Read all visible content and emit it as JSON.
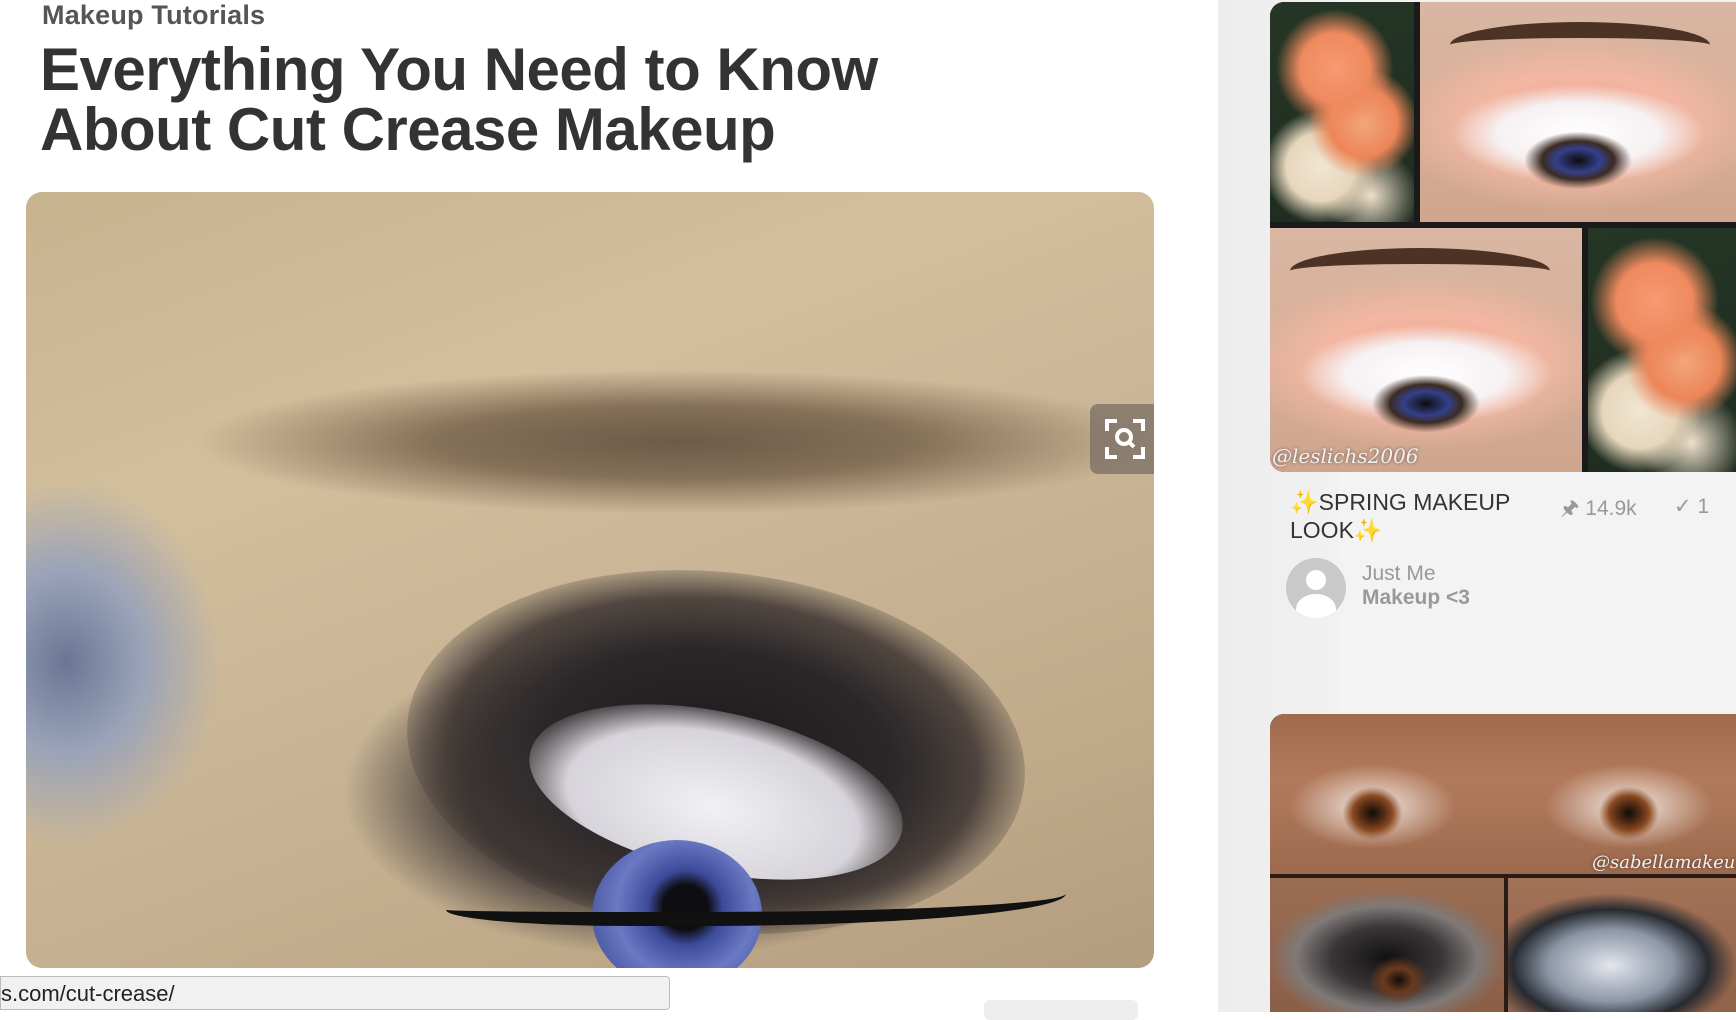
{
  "article": {
    "category": "Makeup Tutorials",
    "title_line1": "Everything You Need to Know",
    "title_line2": "About Cut Crease Makeup"
  },
  "url_bar": {
    "text": "s.com/cut-crease/"
  },
  "side_pin_1": {
    "title_line1": "✨SPRING MAKEUP",
    "title_line2": "LOOK✨",
    "saves": "14.9k",
    "tried": "1",
    "watermark": "@leslichs2006",
    "user": {
      "name_line1": "Just Me",
      "name_line2": "Makeup <3"
    }
  },
  "side_pin_2": {
    "watermark": "@sabellamakeup"
  },
  "icons": [
    "zoom-search-icon",
    "pin-icon",
    "check-icon",
    "user-avatar-icon"
  ],
  "colors": {
    "title": "#333333",
    "muted": "#999999",
    "sidebar_bg": "#f3f3f3"
  }
}
